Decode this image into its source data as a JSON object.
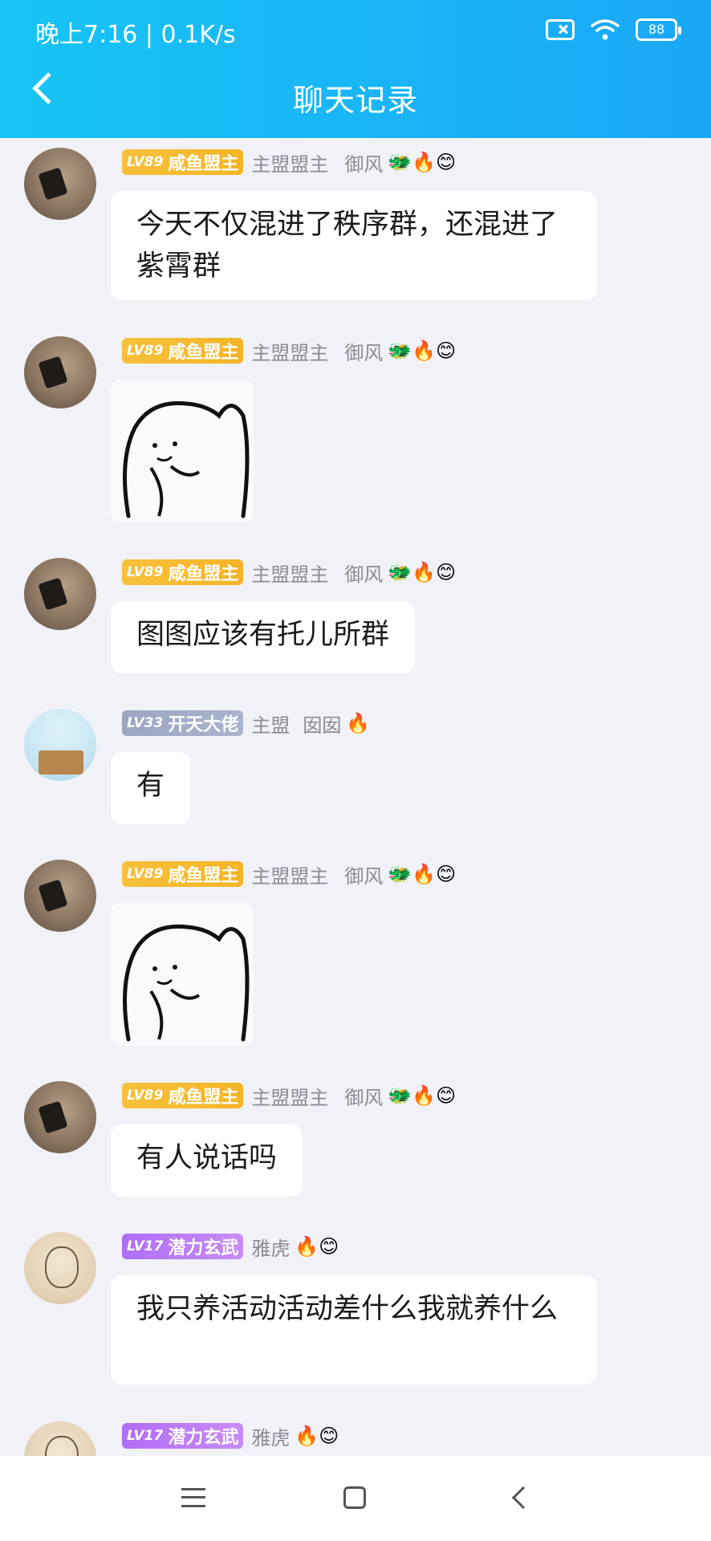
{
  "status_bar": {
    "time": "晚上7:16 | 0.1K/s",
    "battery": "88"
  },
  "header": {
    "title": "聊天记录"
  },
  "messages": [
    {
      "level": "LV89",
      "title": "咸鱼盟主",
      "role": "主盟盟主",
      "name": "御风",
      "badges": "🐲🔥😊",
      "text": "今天不仅混进了秩序群，还混进了紫霄群"
    },
    {
      "level": "LV89",
      "title": "咸鱼盟主",
      "role": "主盟盟主",
      "name": "御风",
      "badges": "🐲🔥😊"
    },
    {
      "level": "LV89",
      "title": "咸鱼盟主",
      "role": "主盟盟主",
      "name": "御风",
      "badges": "🐲🔥😊",
      "text": "图图应该有托儿所群"
    },
    {
      "level": "LV33",
      "title": "开天大佬",
      "role": "主盟",
      "name": "囡囡",
      "badges": "🔥",
      "text": "有"
    },
    {
      "level": "LV89",
      "title": "咸鱼盟主",
      "role": "主盟盟主",
      "name": "御风",
      "badges": "🐲🔥😊"
    },
    {
      "level": "LV89",
      "title": "咸鱼盟主",
      "role": "主盟盟主",
      "name": "御风",
      "badges": "🐲🔥😊",
      "text": "有人说话吗"
    },
    {
      "level": "LV17",
      "title": "潜力玄武",
      "name": "雅虎",
      "badges": "🔥😊",
      "text": "我只养活动活动差什么我就养什么"
    },
    {
      "level": "LV17",
      "title": "潜力玄武",
      "name": "雅虎",
      "badges": "🔥😊"
    }
  ]
}
